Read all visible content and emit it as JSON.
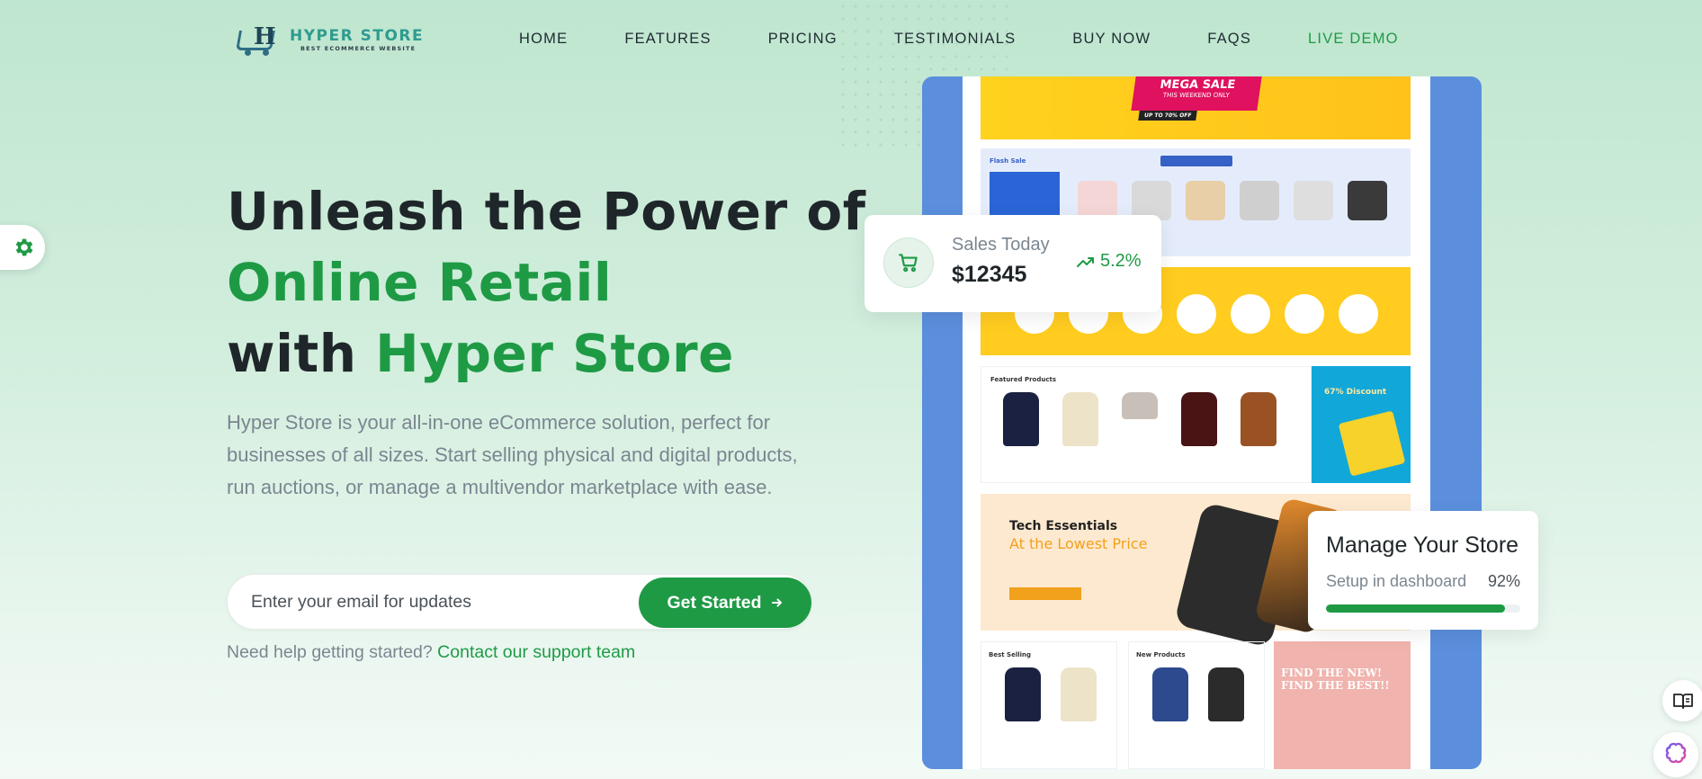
{
  "brand": {
    "name": "HYPER STORE",
    "tagline": "BEST ECOMMERCE WEBSITE",
    "colors": {
      "primary": "#1e9a45",
      "logo": "#2f9b8f"
    }
  },
  "nav": {
    "items": [
      {
        "label": "HOME"
      },
      {
        "label": "FEATURES"
      },
      {
        "label": "PRICING"
      },
      {
        "label": "TESTIMONIALS"
      },
      {
        "label": "BUY NOW"
      },
      {
        "label": "FAQS"
      },
      {
        "label": "LIVE DEMO"
      }
    ]
  },
  "hero": {
    "line1": "Unleash the Power of",
    "line2": "Online Retail",
    "line3_prefix": "with ",
    "line3_highlight": "Hyper Store",
    "description": "Hyper Store is your all-in-one eCommerce solution, perfect for businesses of all sizes. Start selling physical and digital products, run auctions, or manage a multivendor marketplace with ease.",
    "email_placeholder": "Enter your email for updates",
    "cta_label": "Get Started",
    "help_text": "Need help getting started?",
    "help_link": "Contact our support team"
  },
  "sales_card": {
    "label": "Sales Today",
    "value": "$12345",
    "growth": "5.2%",
    "icon": "cart-icon"
  },
  "manage_card": {
    "title": "Manage Your Store",
    "subtitle": "Setup in dashboard",
    "percent": "92%",
    "progress": 0.92
  },
  "preview": {
    "mega_sale": "MEGA SALE",
    "mega_sub": "THIS WEEKEND ONLY",
    "upto": "UP TO 70% OFF",
    "flash_sale": "Flash Sale",
    "featured": "Featured Products",
    "promo_discount": "67% Discount",
    "tech_title": "Tech Essentials",
    "tech_sub": "At the Lowest Price",
    "best_selling": "Best Selling",
    "new_products": "New Products",
    "find": "FIND THE NEW! FIND THE BEST!!"
  },
  "icons": {
    "settings": "gear-icon",
    "docs": "book-icon",
    "ai": "brain-icon",
    "growth": "trend-up-icon",
    "cta": "arrow-right-icon"
  }
}
